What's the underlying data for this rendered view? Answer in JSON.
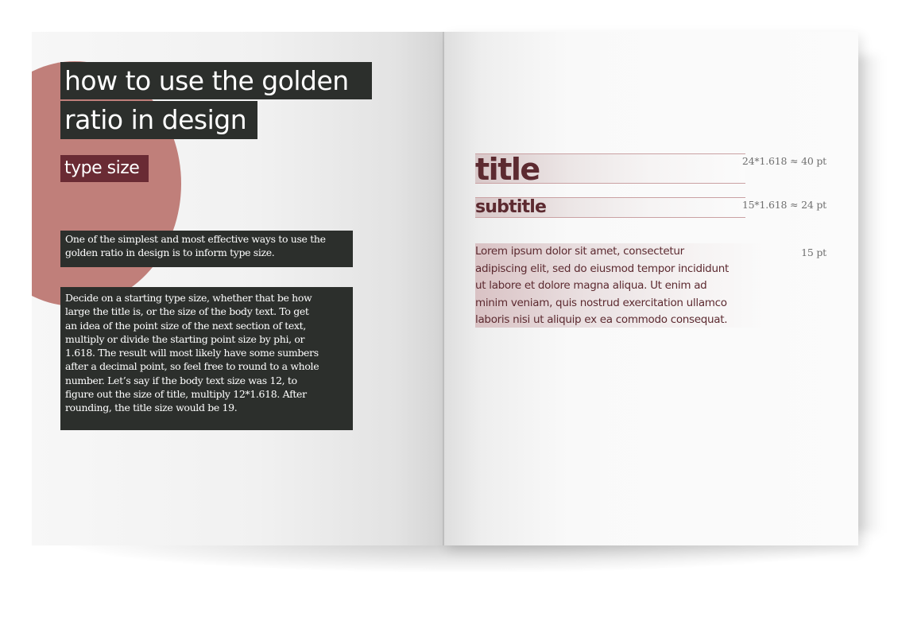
{
  "left_page": {
    "title_line_1": "how to use the golden",
    "title_line_2": "ratio in design",
    "section_label": "type size",
    "paragraph_1": [
      "One of the simplest and most effective ways to use the",
      "golden ratio in design is to inform type size."
    ],
    "paragraph_2": [
      "Decide on a starting type size, whether that be how",
      "large the title is, or the size of the body text. To get",
      "an idea of the point size of the next section of text,",
      "multiply or divide the starting point size by phi, or",
      "1.618. The result will most likely have some sumbers",
      "after a decimal point, so feel free to round to a whole",
      "number. Let’s say if the body text size was 12, to",
      "figure out the size of title, multiply 12*1.618. After",
      "rounding, the title size would be 19."
    ]
  },
  "right_page": {
    "title_sample": "title",
    "title_calc": "24*1.618 ≈ 40 pt",
    "subtitle_sample": "subtitle",
    "subtitle_calc": "15*1.618 ≈ 24 pt",
    "body_size": "15 pt",
    "body_sample": [
      "Lorem ipsum dolor sit amet, consectetur",
      "adipiscing elit, sed do eiusmod tempor incididunt",
      "ut labore et dolore magna aliqua. Ut enim ad",
      "minim veniam, quis nostrud exercitation ullamco",
      "laboris nisi ut aliquip ex ea commodo consequat."
    ]
  },
  "colors": {
    "circle": "#c07f7a",
    "dark_block": "#2c2f2c",
    "accent_block": "#6a2b34",
    "sample_text": "#5c2a30"
  }
}
